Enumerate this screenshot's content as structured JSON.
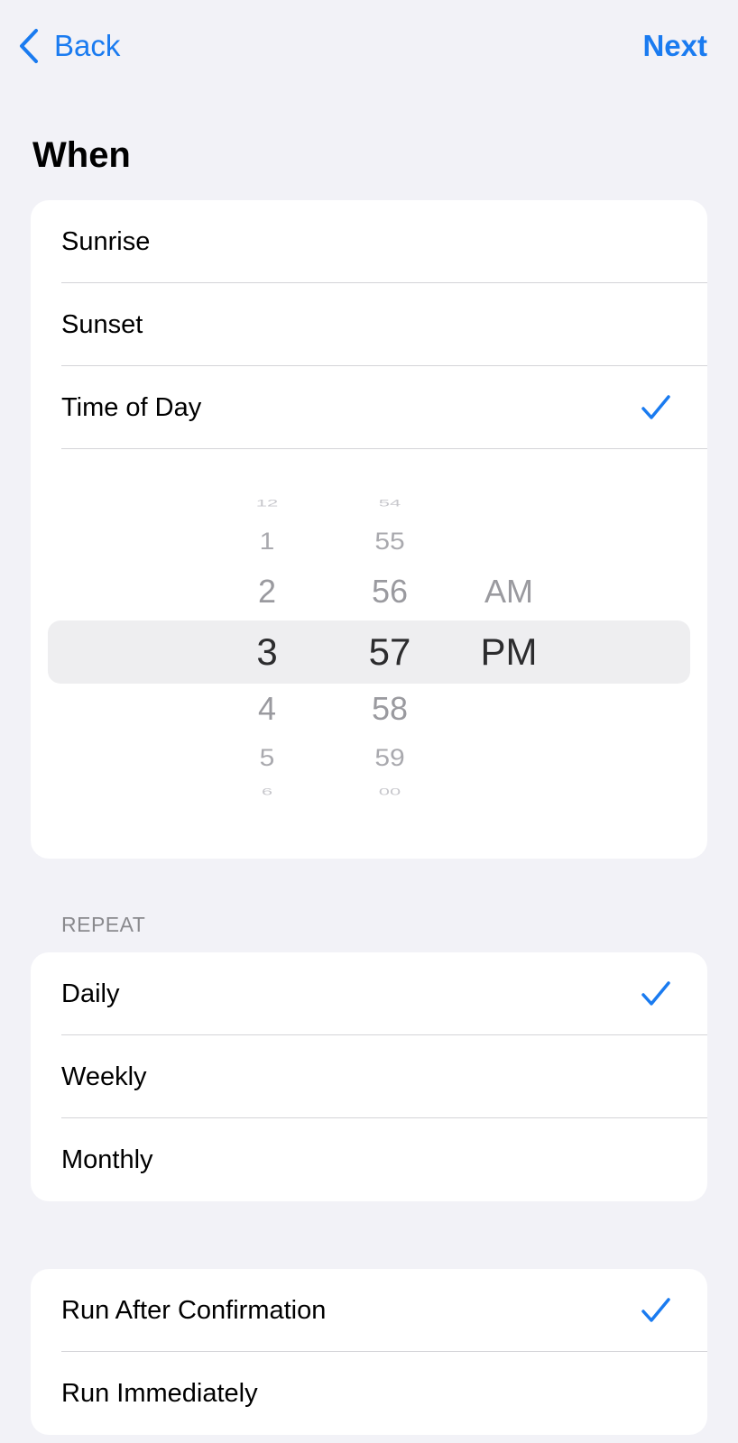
{
  "nav": {
    "back_label": "Back",
    "next_label": "Next",
    "icon": "chevron-left-icon"
  },
  "page_title": "When",
  "when_options": [
    {
      "label": "Sunrise",
      "selected": false
    },
    {
      "label": "Sunset",
      "selected": false
    },
    {
      "label": "Time of Day",
      "selected": true
    }
  ],
  "time_picker": {
    "hours": [
      "12",
      "1",
      "2",
      "3",
      "4",
      "5",
      "6"
    ],
    "minutes": [
      "54",
      "55",
      "56",
      "57",
      "58",
      "59",
      "00"
    ],
    "periods": [
      "AM",
      "PM"
    ],
    "selected": {
      "hour": "3",
      "minute": "57",
      "period": "PM"
    }
  },
  "repeat": {
    "header": "REPEAT",
    "options": [
      {
        "label": "Daily",
        "selected": true
      },
      {
        "label": "Weekly",
        "selected": false
      },
      {
        "label": "Monthly",
        "selected": false
      }
    ]
  },
  "run_options": [
    {
      "label": "Run After Confirmation",
      "selected": true
    },
    {
      "label": "Run Immediately",
      "selected": false
    }
  ],
  "colors": {
    "accent": "#1a7bf0",
    "background": "#f2f2f7",
    "card": "#ffffff",
    "separator": "#d4d4d8",
    "section_header": "#8a8a8e",
    "picker_band": "#eeeef0"
  }
}
